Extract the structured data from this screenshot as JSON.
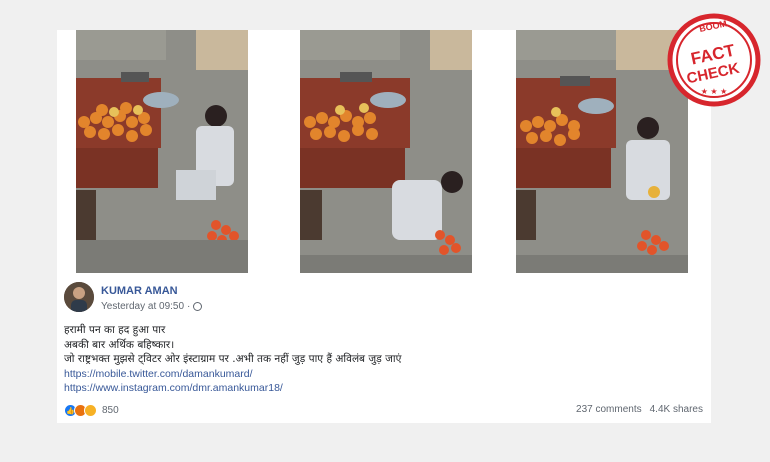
{
  "post": {
    "author": "KUMAR AMAN",
    "timestamp": "Yesterday at 09:50",
    "lines": [
      "हरामी पन का हद हुआ पार",
      "अबकी बार अर्थिक बहिष्कार।",
      "जो राष्ट्रभक्त मुझसे ट्विटर ओर इंस्टाग्राम पर .अभी तक नहीं जुड़ पाए हैं अविलंब जुड़ जाएं"
    ],
    "links": [
      "https://mobile.twitter.com/damankumard/",
      "https://www.instagram.com/dmr.amankumar18/"
    ],
    "reactions_count": "850",
    "comments": "237 comments",
    "shares": "4.4K shares"
  },
  "stamp": {
    "brand": "BOOM",
    "line1": "FACT",
    "line2": "CHECK",
    "color": "#d7262d"
  },
  "colors": {
    "link": "#385898",
    "author": "#385898"
  },
  "icons": [
    "globe-icon",
    "like-reaction-icon",
    "angry-reaction-icon",
    "sad-reaction-icon"
  ]
}
